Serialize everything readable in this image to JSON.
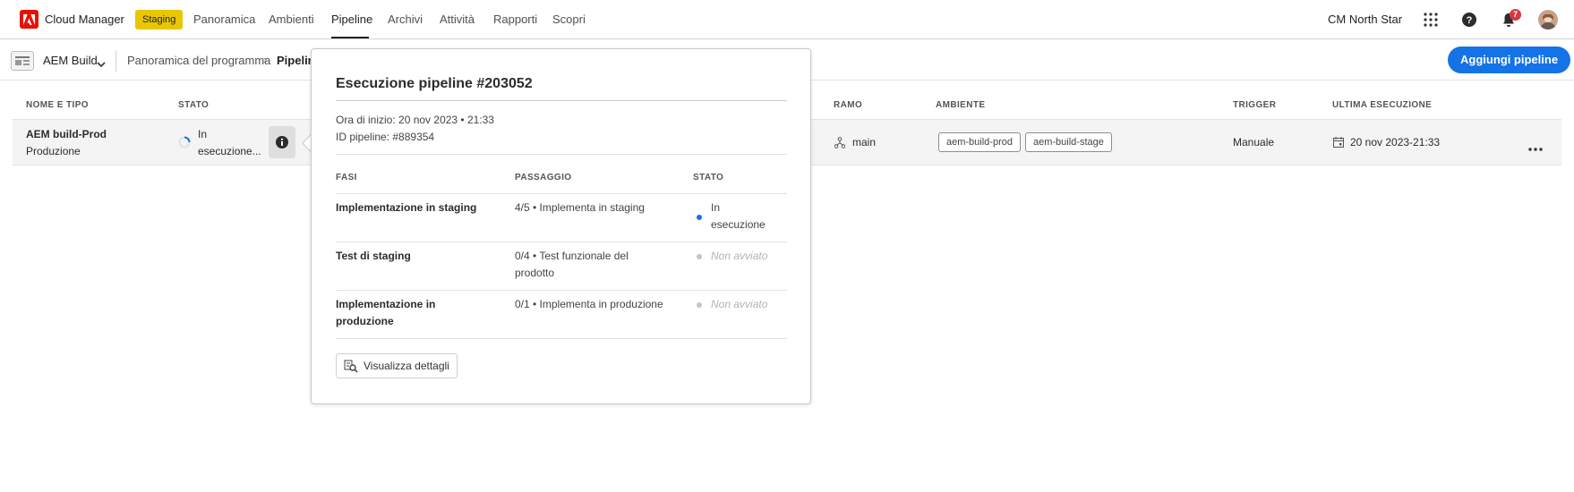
{
  "app": {
    "name": "Cloud Manager",
    "env_badge": "Staging"
  },
  "nav": {
    "items": [
      {
        "label": "Panoramica"
      },
      {
        "label": "Ambienti"
      },
      {
        "label": "Pipeline"
      },
      {
        "label": "Archivi"
      },
      {
        "label": "Attività"
      },
      {
        "label": "Rapporti"
      },
      {
        "label": "Scopri"
      }
    ],
    "active": "Pipeline"
  },
  "header": {
    "org": "CM North Star",
    "notification_count": "7"
  },
  "program": {
    "name": "AEM Build"
  },
  "breadcrumb": {
    "overview": "Panoramica del programma",
    "current": "Pipeline"
  },
  "actions": {
    "add_pipeline": "Aggiungi pipeline"
  },
  "table": {
    "headers": [
      "NOME E TIPO",
      "STATO",
      "RAMO",
      "AMBIENTE",
      "TRIGGER",
      "ULTIMA ESECUZIONE"
    ],
    "row": {
      "name": "AEM build-Prod",
      "type": "Produzione",
      "status_line1": "In",
      "status_line2": "esecuzione...",
      "branch": "main",
      "environments": [
        "aem-build-prod",
        "aem-build-stage"
      ],
      "trigger": "Manuale",
      "last_run": "20 nov 2023-21:33"
    }
  },
  "popover": {
    "title": "Esecuzione pipeline #203052",
    "start_time": "Ora di inizio: 20 nov 2023 • 21:33",
    "pipeline_id": "ID pipeline: #889354",
    "columns": [
      "FASI",
      "PASSAGGIO",
      "STATO"
    ],
    "steps": [
      {
        "phase": "Implementazione in staging",
        "phase_l2": "",
        "step": "4/5 • Implementa in staging",
        "step_l2": "",
        "status": "In",
        "status_l2": "esecuzione",
        "running": true
      },
      {
        "phase": "Test di staging",
        "phase_l2": "",
        "step": "0/4 • Test funzionale del",
        "step_l2": "prodotto",
        "status": "Non avviato",
        "status_l2": "",
        "running": false
      },
      {
        "phase": "Implementazione in",
        "phase_l2": "produzione",
        "step": "0/1 • Implementa in produzione",
        "step_l2": "",
        "status": "Non avviato",
        "status_l2": "",
        "running": false
      }
    ],
    "details_button": "Visualizza dettagli"
  },
  "colors": {
    "accent": "#1473e6",
    "badge": "#e8c600",
    "logo": "#eb1000",
    "notification": "#d7373f"
  }
}
